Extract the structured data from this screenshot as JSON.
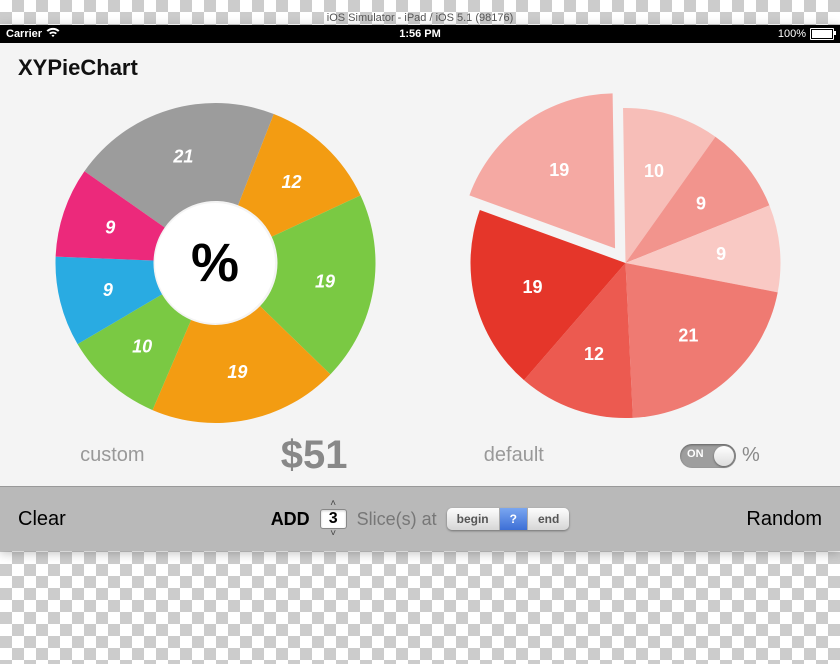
{
  "simulator_title": "iOS Simulator - iPad / iOS 5.1 (98176)",
  "statusbar": {
    "carrier": "Carrier",
    "time": "1:56 PM",
    "battery_pct": "100%"
  },
  "app": {
    "title": "XYPieChart",
    "donut_center": "%",
    "caption_left": "custom",
    "amount": "$51",
    "caption_right": "default",
    "toggle_text": "ON",
    "toggle_suffix": "%"
  },
  "toolbar": {
    "clear": "Clear",
    "add": "ADD",
    "stepper_value": "3",
    "slices_label": "Slice(s)  at",
    "segments": {
      "begin": "begin",
      "mid": "?",
      "end": "end"
    },
    "random": "Random"
  },
  "chart_data": [
    {
      "type": "pie",
      "name": "custom",
      "donut": true,
      "slices": [
        {
          "label": "21",
          "value": 21,
          "color": "#9c9c9c"
        },
        {
          "label": "12",
          "value": 12,
          "color": "#f39c12"
        },
        {
          "label": "19",
          "value": 19,
          "color": "#7ac943"
        },
        {
          "label": "19",
          "value": 19,
          "color": "#f39c12"
        },
        {
          "label": "10",
          "value": 10,
          "color": "#7ac943"
        },
        {
          "label": "9",
          "value": 9,
          "color": "#29abe2"
        },
        {
          "label": "9",
          "value": 9,
          "color": "#ec297b"
        }
      ],
      "start_angle_deg": -55
    },
    {
      "type": "pie",
      "name": "default",
      "donut": false,
      "exploded_index": 0,
      "slices": [
        {
          "label": "19",
          "value": 19,
          "color": "#f5a9a3"
        },
        {
          "label": "10",
          "value": 10,
          "color": "#f7beb8"
        },
        {
          "label": "9",
          "value": 9,
          "color": "#f2948d"
        },
        {
          "label": "9",
          "value": 9,
          "color": "#f9c9c4"
        },
        {
          "label": "21",
          "value": 21,
          "color": "#ef7a72"
        },
        {
          "label": "12",
          "value": 12,
          "color": "#ec5a50"
        },
        {
          "label": "19",
          "value": 19,
          "color": "#e5362a"
        }
      ],
      "start_angle_deg": -70
    }
  ]
}
